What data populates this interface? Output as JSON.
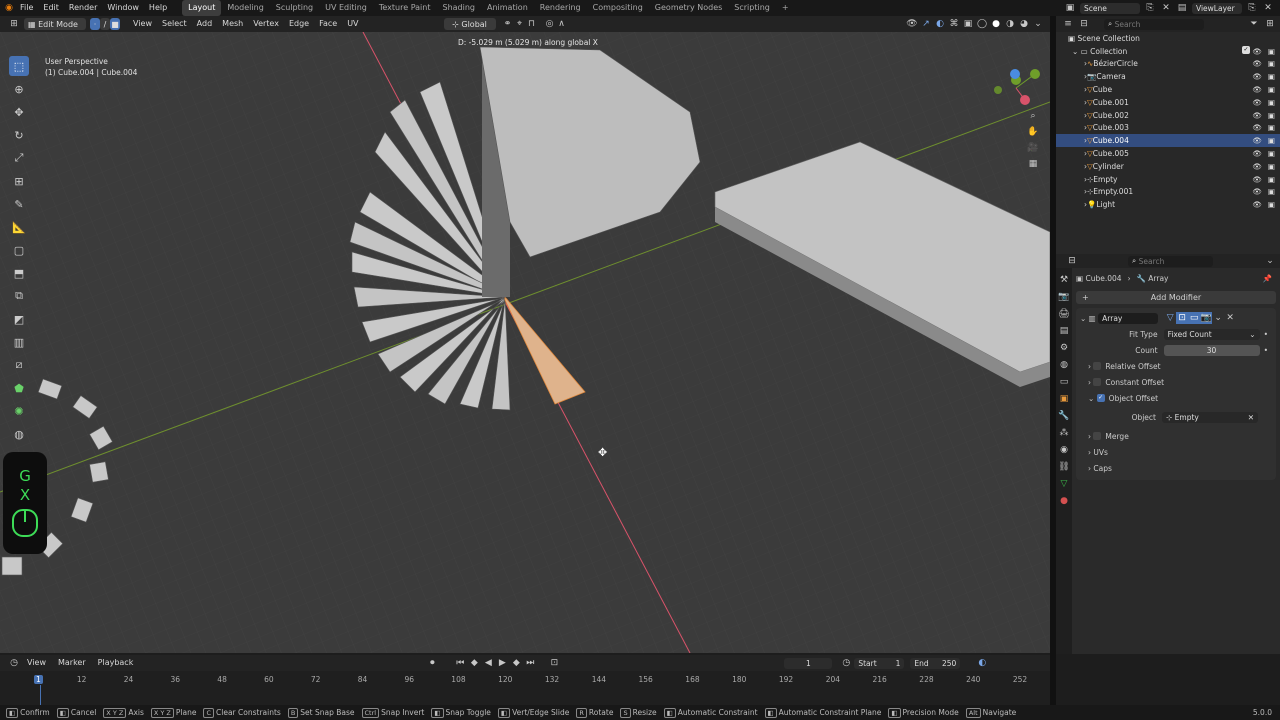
{
  "menubar": {
    "items": [
      "File",
      "Edit",
      "Render",
      "Window",
      "Help"
    ],
    "workspaces": [
      "Layout",
      "Modeling",
      "Sculpting",
      "UV Editing",
      "Texture Paint",
      "Shading",
      "Animation",
      "Rendering",
      "Compositing",
      "Geometry Nodes",
      "Scripting"
    ],
    "active_workspace": "Layout",
    "plus": "+",
    "scene": "Scene",
    "view_layer": "ViewLayer"
  },
  "viewport_header": {
    "mode": "Edit Mode",
    "menus": [
      "View",
      "Select",
      "Add",
      "Mesh",
      "Vertex",
      "Edge",
      "Face",
      "UV"
    ],
    "orientation": "Global"
  },
  "viewport": {
    "transform_info": "D: -5.029 m (5.029 m) along global X",
    "perspective": "User Perspective",
    "object_info": "(1) Cube.004 | Cube.004",
    "overlay_keys": [
      "G",
      "X"
    ]
  },
  "outliner": {
    "title": "Scene Collection",
    "search_placeholder": "Search",
    "collection": "Collection",
    "items": [
      {
        "name": "BézierCircle",
        "type": "curve"
      },
      {
        "name": "Camera",
        "type": "camera"
      },
      {
        "name": "Cube",
        "type": "mesh"
      },
      {
        "name": "Cube.001",
        "type": "mesh"
      },
      {
        "name": "Cube.002",
        "type": "mesh"
      },
      {
        "name": "Cube.003",
        "type": "mesh"
      },
      {
        "name": "Cube.004",
        "type": "mesh",
        "selected": true
      },
      {
        "name": "Cube.005",
        "type": "mesh"
      },
      {
        "name": "Cylinder",
        "type": "mesh"
      },
      {
        "name": "Empty",
        "type": "empty"
      },
      {
        "name": "Empty.001",
        "type": "empty"
      },
      {
        "name": "Light",
        "type": "light"
      }
    ]
  },
  "properties": {
    "search_placeholder": "Search",
    "breadcrumb_object": "Cube.004",
    "breadcrumb_modifier": "Array",
    "add_modifier": "Add Modifier",
    "modifier_name": "Array",
    "fit_type_label": "Fit Type",
    "fit_type_value": "Fixed Count",
    "count_label": "Count",
    "count_value": "30",
    "relative_offset": "Relative Offset",
    "constant_offset": "Constant Offset",
    "object_offset": "Object Offset",
    "object_label": "Object",
    "object_value": "Empty",
    "merge": "Merge",
    "uvs": "UVs",
    "caps": "Caps"
  },
  "timeline": {
    "menus": [
      "View",
      "Marker",
      "Playback"
    ],
    "current_frame": "1",
    "start_label": "Start",
    "start_value": "1",
    "end_label": "End",
    "end_value": "250",
    "ticks": [
      "1",
      "12",
      "24",
      "36",
      "48",
      "60",
      "72",
      "84",
      "96",
      "108",
      "120",
      "132",
      "144",
      "156",
      "168",
      "180",
      "192",
      "204",
      "216",
      "228",
      "240",
      "252"
    ]
  },
  "statusbar": {
    "items": [
      {
        "key": "",
        "label": "Confirm"
      },
      {
        "key": "",
        "label": "Cancel"
      },
      {
        "key": "X Y Z",
        "label": "Axis"
      },
      {
        "key": "X Y Z",
        "label": "Plane"
      },
      {
        "key": "C",
        "label": "Clear Constraints"
      },
      {
        "key": "B",
        "label": "Set Snap Base"
      },
      {
        "key": "Ctrl",
        "label": "Snap Invert"
      },
      {
        "key": "",
        "label": "Snap Toggle"
      },
      {
        "key": "",
        "label": "Vert/Edge Slide"
      },
      {
        "key": "R",
        "label": "Rotate"
      },
      {
        "key": "S",
        "label": "Resize"
      },
      {
        "key": "",
        "label": "Automatic Constraint"
      },
      {
        "key": "",
        "label": "Automatic Constraint Plane"
      },
      {
        "key": "",
        "label": "Precision Mode"
      },
      {
        "key": "Alt",
        "label": "Navigate"
      }
    ],
    "version": "5.0.0"
  }
}
